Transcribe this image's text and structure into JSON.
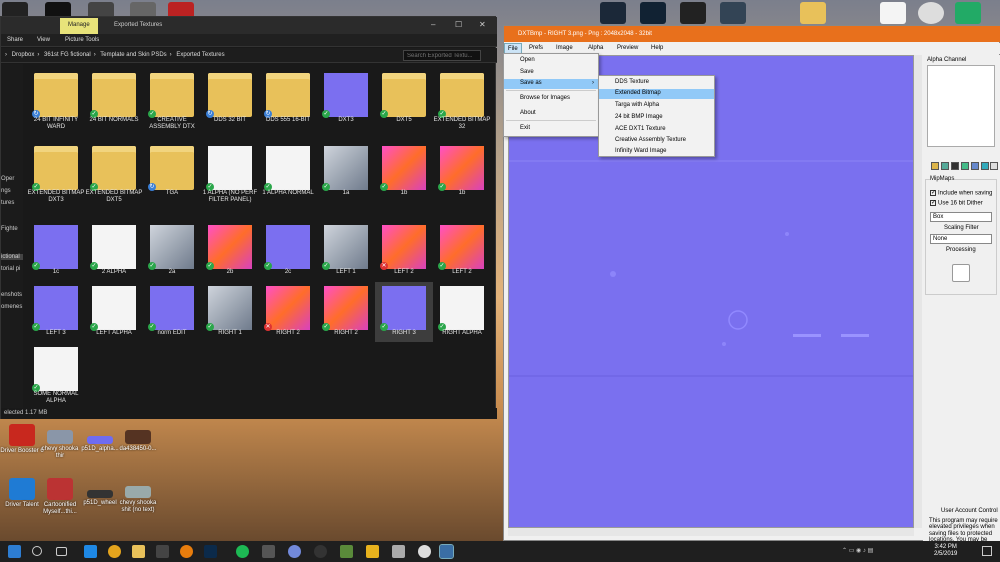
{
  "explorer": {
    "ribbon_tab_manage": "Manage",
    "window_title": "Exported Textures",
    "ribbon": {
      "share": "Share",
      "view": "View",
      "picture_tools": "Picture Tools"
    },
    "breadcrumb": [
      "Dropbox",
      "361st FG fictional",
      "Template and Skin PSDs",
      "Exported Textures"
    ],
    "search_placeholder": "Search Exported Textu...",
    "nav_items": [
      "Oper",
      "ngs",
      "tures",
      "Fighte",
      "ictional",
      "torial pi",
      "enshots",
      "omenes"
    ],
    "status": "elected  1.17 MB",
    "files": [
      {
        "label": "24 BIT INFINITY WARD",
        "kind": "folder",
        "status": "sync"
      },
      {
        "label": "24 BIT NORMALS",
        "kind": "folder",
        "status": "ok"
      },
      {
        "label": "CREATIVE ASSEMBLY DTX",
        "kind": "folder",
        "status": "ok"
      },
      {
        "label": "DDS 32 BIT",
        "kind": "folder",
        "status": "sync"
      },
      {
        "label": "DDS 555 16-BIT",
        "kind": "folder",
        "status": "sync"
      },
      {
        "label": "DXT3",
        "kind": "blue",
        "status": "ok"
      },
      {
        "label": "DXT5",
        "kind": "folder",
        "status": "ok"
      },
      {
        "label": "EXTENDED BITMAP 32",
        "kind": "folder",
        "status": "ok"
      },
      {
        "label": "EXTENDED BITMAP DXT3",
        "kind": "folder",
        "status": "ok"
      },
      {
        "label": "EXTENDED BITMAP DXT5",
        "kind": "folder",
        "status": "ok"
      },
      {
        "label": "TGA",
        "kind": "folder",
        "status": "sync"
      },
      {
        "label": "1 ALPHA (NO PERF FILTER PANEL)",
        "kind": "white",
        "status": "ok"
      },
      {
        "label": "1 ALPHA NORMAL",
        "kind": "white",
        "status": "ok"
      },
      {
        "label": "1a",
        "kind": "gray",
        "status": "ok"
      },
      {
        "label": "1b",
        "kind": "pink",
        "status": "ok"
      },
      {
        "label": "1b",
        "kind": "pink",
        "status": "ok"
      },
      {
        "label": "1c",
        "kind": "blue",
        "status": "ok"
      },
      {
        "label": "2 ALPHA",
        "kind": "white",
        "status": "ok"
      },
      {
        "label": "2a",
        "kind": "gray",
        "status": "ok"
      },
      {
        "label": "2b",
        "kind": "pink",
        "status": "ok"
      },
      {
        "label": "2c",
        "kind": "blue",
        "status": "ok"
      },
      {
        "label": "LEFT 1",
        "kind": "gray",
        "status": "ok"
      },
      {
        "label": "LEFT 2",
        "kind": "pink",
        "status": "err"
      },
      {
        "label": "LEFT 2",
        "kind": "pink",
        "status": "ok"
      },
      {
        "label": "LEFT 3",
        "kind": "blue",
        "status": "ok"
      },
      {
        "label": "LEFT ALPHA",
        "kind": "white",
        "status": "ok"
      },
      {
        "label": "norm EDIT",
        "kind": "blue",
        "status": "ok"
      },
      {
        "label": "RIGHT 1",
        "kind": "gray",
        "status": "ok"
      },
      {
        "label": "RIGHT 2",
        "kind": "pink",
        "status": "err"
      },
      {
        "label": "RIGHT 2",
        "kind": "pink",
        "status": "ok"
      },
      {
        "label": "RIGHT 3",
        "kind": "blue",
        "status": "ok",
        "selected": true
      },
      {
        "label": "RIGHT ALPHA",
        "kind": "white",
        "status": "ok"
      },
      {
        "label": "SOME NORMAL ALPHA",
        "kind": "white",
        "status": "ok"
      }
    ]
  },
  "desktop_icons": [
    {
      "label": "Driver Booster 6",
      "color": "#c8281e"
    },
    {
      "label": "chevy shooka thir",
      "color": "#8a96a8"
    },
    {
      "label": "p51D_alpha...",
      "color": "#6f6cf0"
    },
    {
      "label": "da438450-0...",
      "color": "#553322"
    },
    {
      "label": "Driver Talent",
      "color": "#1f7bd4"
    },
    {
      "label": "Cartoonified Myself...thi...",
      "color": "#b33"
    },
    {
      "label": "p51D_wheel",
      "color": "#333"
    },
    {
      "label": "chevy shooka shit (no text)",
      "color": "#9aa"
    }
  ],
  "dxtbmp": {
    "title": "DXTBmp - RIGHT 3.png - Png : 2048x2048 - 32bit",
    "menu": [
      "File",
      "Prefs",
      "Image",
      "Alpha",
      "Preview",
      "Help"
    ],
    "file_menu": [
      "Open",
      "Save",
      "Save as",
      "Browse for Images",
      "About",
      "Exit"
    ],
    "save_as_menu": [
      "DDS Texture",
      "Extended Bitmap",
      "Targa with Alpha",
      "24 bit BMP Image",
      "ACE DXT1 Texture",
      "Creative Assembly Texture",
      "Infinity Ward Image"
    ],
    "alpha_channel_label": "Alpha Channel",
    "mipmaps_label": "MipMaps",
    "include_when_saving": "Include when saving",
    "use_16bit_dither": "Use 16 bit Dither",
    "mip_filter_value": "Box",
    "scaling_filter_label": "Scaling Filter",
    "scaling_filter_value": "None",
    "processing_label": "Processing",
    "uac_title": "User Account Control",
    "uac_text": "This program may require elevated privileges when saving files to protected locations. You may be presented with the UAC prompt when saving files"
  },
  "clock": {
    "time": "3:42 PM",
    "date": "2/5/2019"
  },
  "colors": {
    "accent": "#e8701c",
    "normal_map": "#7a70ef"
  }
}
